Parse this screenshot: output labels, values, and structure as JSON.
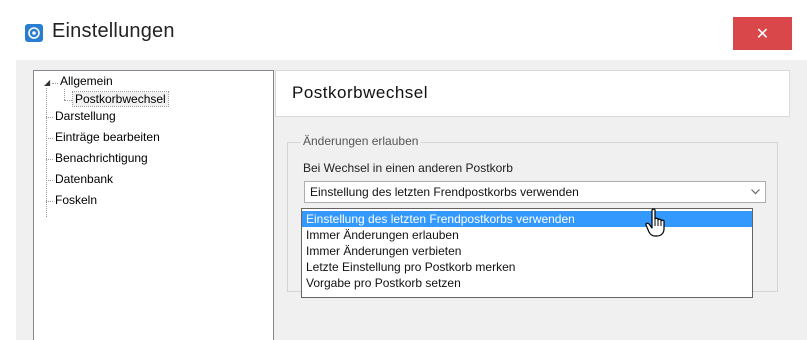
{
  "window": {
    "title": "Einstellungen",
    "close_label": "✕",
    "accent": "#2a7ed0",
    "close_color": "#d9474a"
  },
  "tree": {
    "items": [
      {
        "label": "Allgemein",
        "expanded": true
      },
      {
        "label": "Postkorbwechsel",
        "selected": true
      },
      {
        "label": "Darstellung"
      },
      {
        "label": "Einträge bearbeiten"
      },
      {
        "label": "Benachrichtigung"
      },
      {
        "label": "Datenbank"
      },
      {
        "label": "Foskeln"
      }
    ]
  },
  "pane": {
    "title": "Postkorbwechsel",
    "group_legend": "Änderungen erlauben",
    "field_label": "Bei Wechsel in einen anderen Postkorb",
    "combo_value": "Einstellung des letzten Frendpostkorbs verwenden",
    "options": [
      "Einstellung des letzten Frendpostkorbs verwenden",
      "Immer Änderungen erlauben",
      "Immer Änderungen verbieten",
      "Letzte Einstellung pro Postkorb merken",
      "Vorgabe pro Postkorb setzen"
    ],
    "highlight_color": "#3399ff"
  }
}
